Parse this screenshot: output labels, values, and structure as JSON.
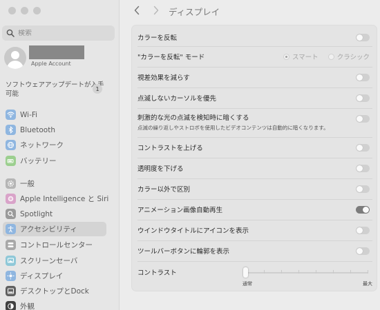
{
  "window": {
    "title": "ディスプレイ"
  },
  "search": {
    "placeholder": "検索"
  },
  "account": {
    "subtitle": "Apple Account"
  },
  "update": {
    "label": "ソフトウェアアップデートが入手可能",
    "badge": "1"
  },
  "sidebar": {
    "items": [
      {
        "label": "Wi-Fi",
        "icon": "wifi-icon",
        "color": "#8fb6e0",
        "selected": false
      },
      {
        "label": "Bluetooth",
        "icon": "bluetooth-icon",
        "color": "#8fb6e0",
        "selected": false
      },
      {
        "label": "ネットワーク",
        "icon": "globe-icon",
        "color": "#8fb6e0",
        "selected": false
      },
      {
        "label": "バッテリー",
        "icon": "battery-icon",
        "color": "#9ccf8f",
        "selected": false
      },
      {
        "label": "一般",
        "icon": "gear-icon",
        "color": "#b5b5b5",
        "selected": false
      },
      {
        "label": "Apple Intelligence と Siri",
        "icon": "siri-icon",
        "color": "#d9a3c9",
        "selected": false
      },
      {
        "label": "Spotlight",
        "icon": "spotlight-search-icon",
        "color": "#9a9a9a",
        "selected": false
      },
      {
        "label": "アクセシビリティ",
        "icon": "accessibility-icon",
        "color": "#8fb6e0",
        "selected": true
      },
      {
        "label": "コントロールセンター",
        "icon": "control-center-icon",
        "color": "#a8a8a8",
        "selected": false
      },
      {
        "label": "スクリーンセーバ",
        "icon": "screensaver-icon",
        "color": "#8fc8d8",
        "selected": false
      },
      {
        "label": "ディスプレイ",
        "icon": "display-icon",
        "color": "#8fb6e0",
        "selected": false
      },
      {
        "label": "デスクトップとDock",
        "icon": "dock-icon",
        "color": "#606060",
        "selected": false
      },
      {
        "label": "外観",
        "icon": "appearance-icon",
        "color": "#404040",
        "selected": false
      }
    ]
  },
  "settings": {
    "invert_colors": {
      "label": "カラーを反転",
      "on": false
    },
    "invert_mode": {
      "label": "\"カラーを反転\" モード",
      "options": [
        "スマート",
        "クラシック"
      ],
      "selected": "スマート"
    },
    "reduce_motion": {
      "label": "視差効果を減らす",
      "on": false
    },
    "prefer_nonblinking_cursor": {
      "label": "点滅しないカーソルを優先",
      "on": false
    },
    "dim_flashing": {
      "label": "刺激的な光の点滅を検知時に暗くする",
      "description": "点滅の繰り返しやストロボを使用したビデオコンテンツは自動的に暗くなります。",
      "on": false
    },
    "increase_contrast": {
      "label": "コントラストを上げる",
      "on": false
    },
    "reduce_transparency": {
      "label": "透明度を下げる",
      "on": false
    },
    "differentiate_without_color": {
      "label": "カラー以外で区別",
      "on": false
    },
    "autoplay_animated_images": {
      "label": "アニメーション画像自動再生",
      "on": true
    },
    "show_window_title_icons": {
      "label": "ウインドウタイトルにアイコンを表示",
      "on": false
    },
    "show_toolbar_button_shapes": {
      "label": "ツールバーボタンに輪郭を表示",
      "on": false
    },
    "display_contrast": {
      "label": "コントラスト",
      "min_label": "通常",
      "max_label": "最大",
      "value": 0
    }
  }
}
